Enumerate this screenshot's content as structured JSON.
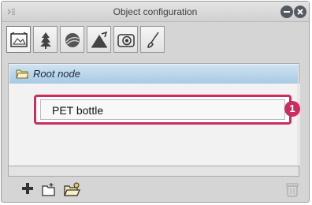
{
  "window": {
    "title": "Object configuration"
  },
  "toolbar": {
    "tools": [
      {
        "name": "camera-frame-icon",
        "active": true
      },
      {
        "name": "tree-icon",
        "active": false
      },
      {
        "name": "sphere-icon",
        "active": false
      },
      {
        "name": "mountain-perspective-icon",
        "active": false
      },
      {
        "name": "spiral-icon",
        "active": false
      },
      {
        "name": "brush-icon",
        "active": false
      }
    ]
  },
  "tree": {
    "root_label": "Root node",
    "items": [
      {
        "label": "PET bottle",
        "callout": "1"
      }
    ]
  },
  "colors": {
    "accent": "#cc2c62",
    "root_highlight": "#a8c9e3",
    "panel": "#d5d5d5"
  },
  "bottom_bar": {
    "icons": [
      "add-icon",
      "new-folder-icon",
      "open-folder-icon",
      "trash-icon"
    ]
  }
}
